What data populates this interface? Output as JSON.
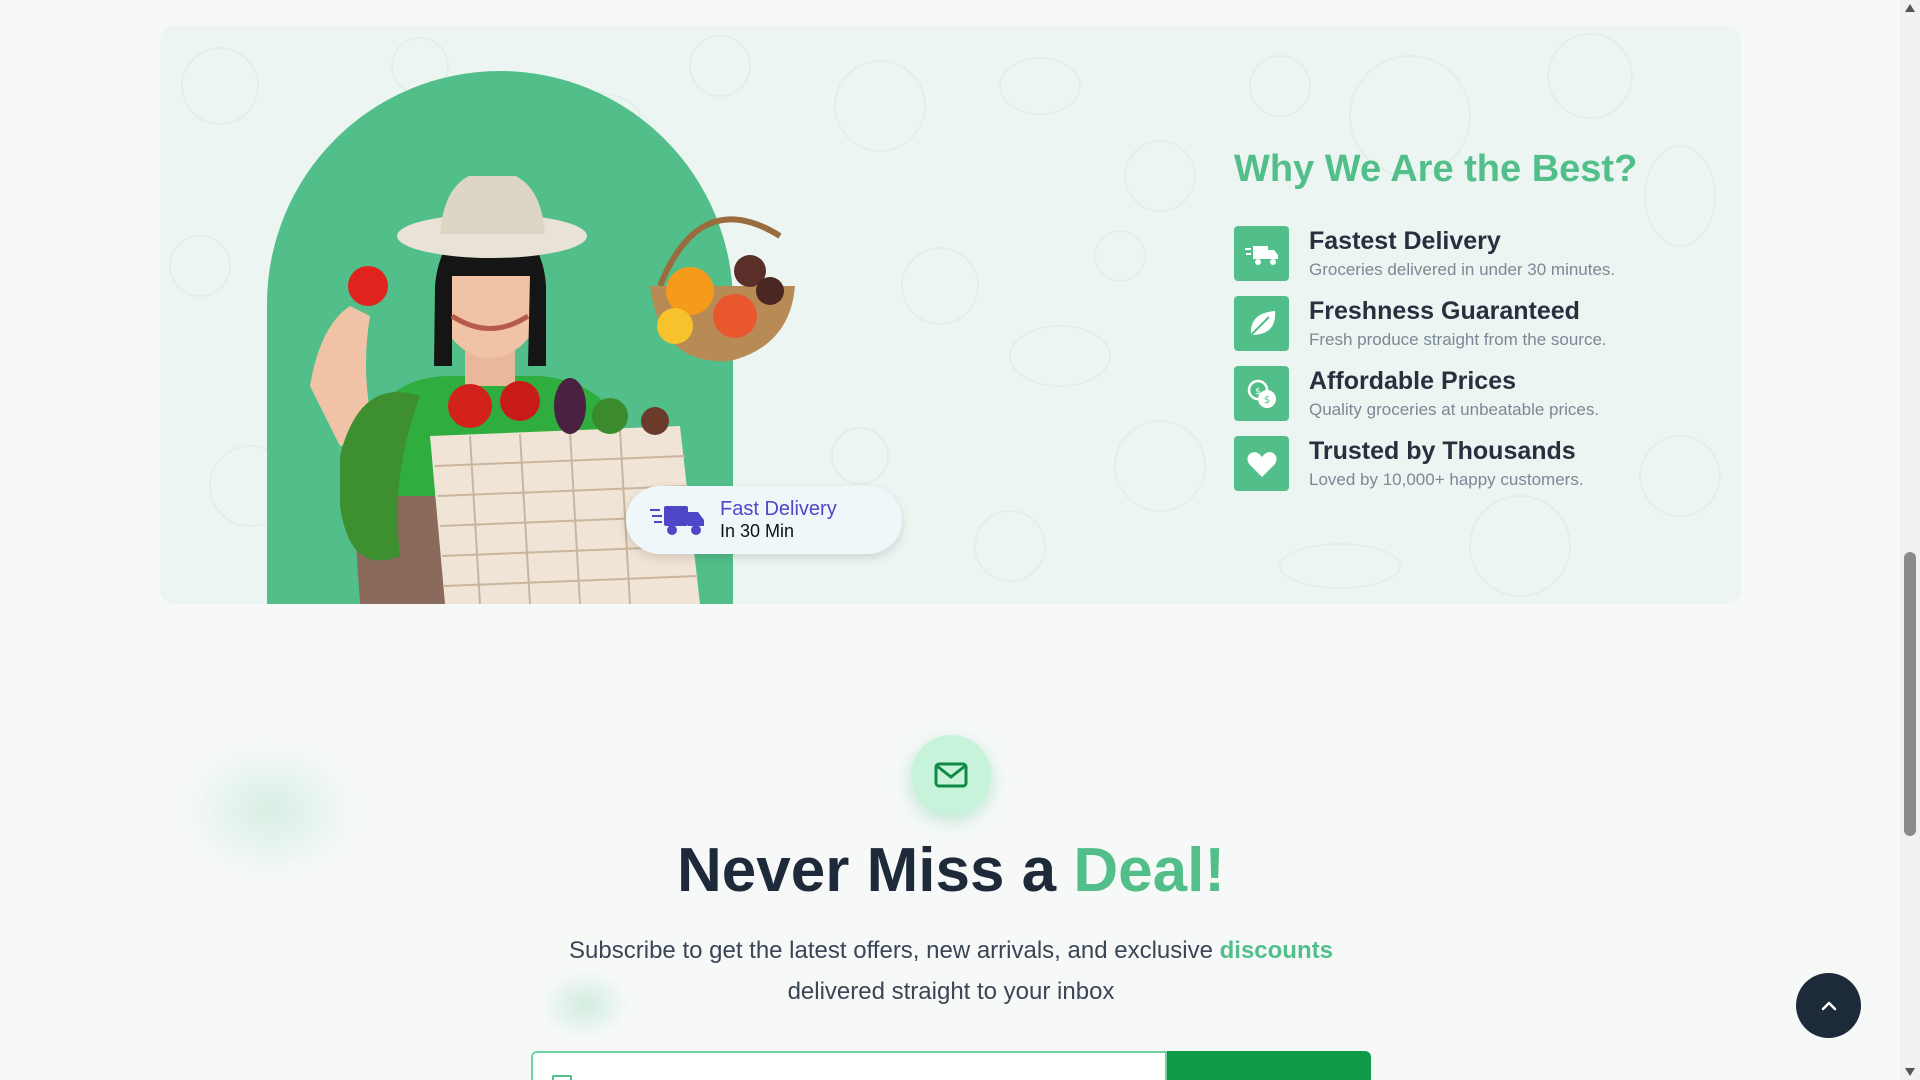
{
  "why_section": {
    "title": "Why We Are the Best?",
    "badge": {
      "title": "Fast Delivery",
      "subtitle": "In 30 Min",
      "icon": "delivery-truck-icon"
    },
    "features": [
      {
        "icon": "truck-icon",
        "name": "Fastest Delivery",
        "desc": "Groceries delivered in under 30 minutes."
      },
      {
        "icon": "leaf-icon",
        "name": "Freshness Guaranteed",
        "desc": "Fresh produce straight from the source."
      },
      {
        "icon": "coins-icon",
        "name": "Affordable Prices",
        "desc": "Quality groceries at unbeatable prices."
      },
      {
        "icon": "heart-icon",
        "name": "Trusted by Thousands",
        "desc": "Loved by 10,000+ happy customers."
      }
    ]
  },
  "newsletter": {
    "icon": "mail-icon",
    "title_main": "Never Miss a ",
    "title_accent": "Deal!",
    "subtitle_part1": "Subscribe to get the latest offers, new arrivals, and exclusive ",
    "subtitle_accent": "discounts",
    "subtitle_part2": "delivered straight to your inbox",
    "email_placeholder": "",
    "subscribe_label": ""
  },
  "colors": {
    "accent": "#52bf8a",
    "dark": "#1e2a3a",
    "badge_text": "#4f46c8",
    "button": "#0f9a4a"
  }
}
